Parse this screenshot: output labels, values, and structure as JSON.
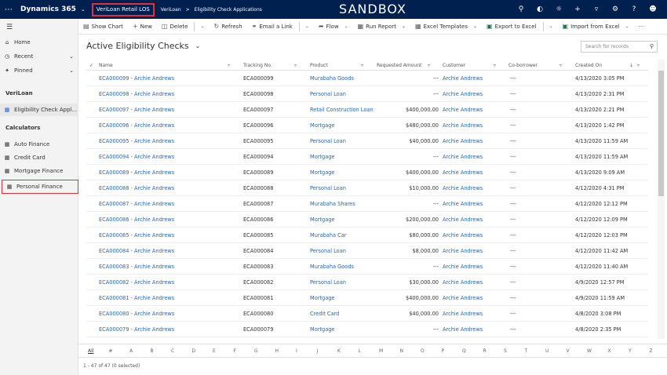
{
  "topbar": {
    "app": "Dynamics 365",
    "module": "VeriLoan Retail LOS",
    "crumbs": [
      "VeriLoan",
      ">",
      "Eligibility Check Applications"
    ],
    "env": "SANDBOX",
    "icons": [
      "search-icon",
      "assistant-icon",
      "lightbulb-icon",
      "plus-icon",
      "filter-icon",
      "gear-icon",
      "help-icon",
      "user-icon"
    ]
  },
  "sidebar": {
    "home": "Home",
    "recent": "Recent",
    "pinned": "Pinned",
    "section1": "VeriLoan",
    "eca": "Eligibility Check Appl...",
    "section2": "Calculators",
    "calcs": [
      "Auto Finance",
      "Credit Card",
      "Mortgage Finance",
      "Personal Finance"
    ]
  },
  "commands": {
    "show_chart": "Show Chart",
    "new": "New",
    "delete": "Delete",
    "refresh": "Refresh",
    "email_link": "Email a Link",
    "flow": "Flow",
    "run_report": "Run Report",
    "excel_templates": "Excel Templates",
    "export_excel": "Export to Excel",
    "import_excel": "Import from Excel",
    "more": "···"
  },
  "view": {
    "title": "Active Eligibility Checks",
    "search_placeholder": "Search for records"
  },
  "columns": [
    "Name",
    "Tracking No.",
    "Product",
    "Requested Amount",
    "Customer",
    "Co-borrower",
    "Created On"
  ],
  "rows": [
    [
      "ECA000099 - Archie Andrews",
      "ECA000099",
      "Murabaha Goods",
      "---",
      "Archie Andrews",
      "---",
      "4/13/2020 3:05 PM"
    ],
    [
      "ECA000098 - Archie Andrews",
      "ECA000098",
      "Personal Loan",
      "---",
      "Archie Andrews",
      "---",
      "4/13/2020 2:31 PM"
    ],
    [
      "ECA000097 - Archie Andrews",
      "ECA000097",
      "Retail Construction Loan",
      "$400,000.00",
      "Archie Andrews",
      "---",
      "4/13/2020 2:21 PM"
    ],
    [
      "ECA000096 - Archie Andrews",
      "ECA000096",
      "Mortgage",
      "$480,000.00",
      "Archie Andrews",
      "---",
      "4/13/2020 1:42 PM"
    ],
    [
      "ECA000095 - Archie Andrews",
      "ECA000095",
      "Personal Loan",
      "$40,000.00",
      "Archie Andrews",
      "---",
      "4/13/2020 11:59 AM"
    ],
    [
      "ECA000094 - Archie Andrews",
      "ECA000094",
      "Mortgage",
      "---",
      "Archie Andrews",
      "---",
      "4/13/2020 11:59 AM"
    ],
    [
      "ECA000089 - Archie Andrews",
      "ECA000089",
      "Mortgage",
      "$400,000.00",
      "Archie Andrews",
      "---",
      "4/13/2020 9:09 AM"
    ],
    [
      "ECA000088 - Archie Andrews",
      "ECA000088",
      "Personal Loan",
      "$10,000.00",
      "Archie Andrews",
      "---",
      "4/12/2020 4:31 PM"
    ],
    [
      "ECA000087 - Archie Andrews",
      "ECA000087",
      "Murabaha Shares",
      "---",
      "Archie Andrews",
      "---",
      "4/12/2020 12:12 PM"
    ],
    [
      "ECA000086 - Archie Andrews",
      "ECA000086",
      "Mortgage",
      "$200,000.00",
      "Archie Andrews",
      "---",
      "4/12/2020 12:09 PM"
    ],
    [
      "ECA000085 - Archie Andrews",
      "ECA000085",
      "Murabaha Car",
      "$80,000.00",
      "Archie Andrews",
      "---",
      "4/12/2020 12:03 PM"
    ],
    [
      "ECA000084 - Archie Andrews",
      "ECA000084",
      "Personal Loan",
      "$8,000.00",
      "Archie Andrews",
      "---",
      "4/12/2020 11:42 AM"
    ],
    [
      "ECA000083 - Archie Andrews",
      "ECA000083",
      "Murabaha Goods",
      "---",
      "Archie Andrews",
      "---",
      "4/12/2020 11:40 AM"
    ],
    [
      "ECA000082 - Archie Andrews",
      "ECA000082",
      "Personal Loan",
      "$30,000.00",
      "Archie Andrews",
      "---",
      "4/9/2020 12:57 PM"
    ],
    [
      "ECA000081 - Archie Andrews",
      "ECA000081",
      "Mortgage",
      "$400,000.00",
      "Archie Andrews",
      "---",
      "4/9/2020 11:59 AM"
    ],
    [
      "ECA000080 - Archie Andrews",
      "ECA000080",
      "Credit Card",
      "$40,000.00",
      "Archie Andrews",
      "---",
      "4/8/2020 3:08 PM"
    ],
    [
      "ECA000079 - Archie Andrews",
      "ECA000079",
      "Mortgage",
      "---",
      "Archie Andrews",
      "---",
      "4/8/2020 2:35 PM"
    ]
  ],
  "alphabet": [
    "All",
    "#",
    "A",
    "B",
    "C",
    "D",
    "E",
    "F",
    "G",
    "H",
    "I",
    "J",
    "K",
    "L",
    "M",
    "N",
    "O",
    "P",
    "Q",
    "R",
    "S",
    "T",
    "U",
    "V",
    "W",
    "X",
    "Y",
    "Z"
  ],
  "footer": "1 - 47 of 47 (0 selected)"
}
